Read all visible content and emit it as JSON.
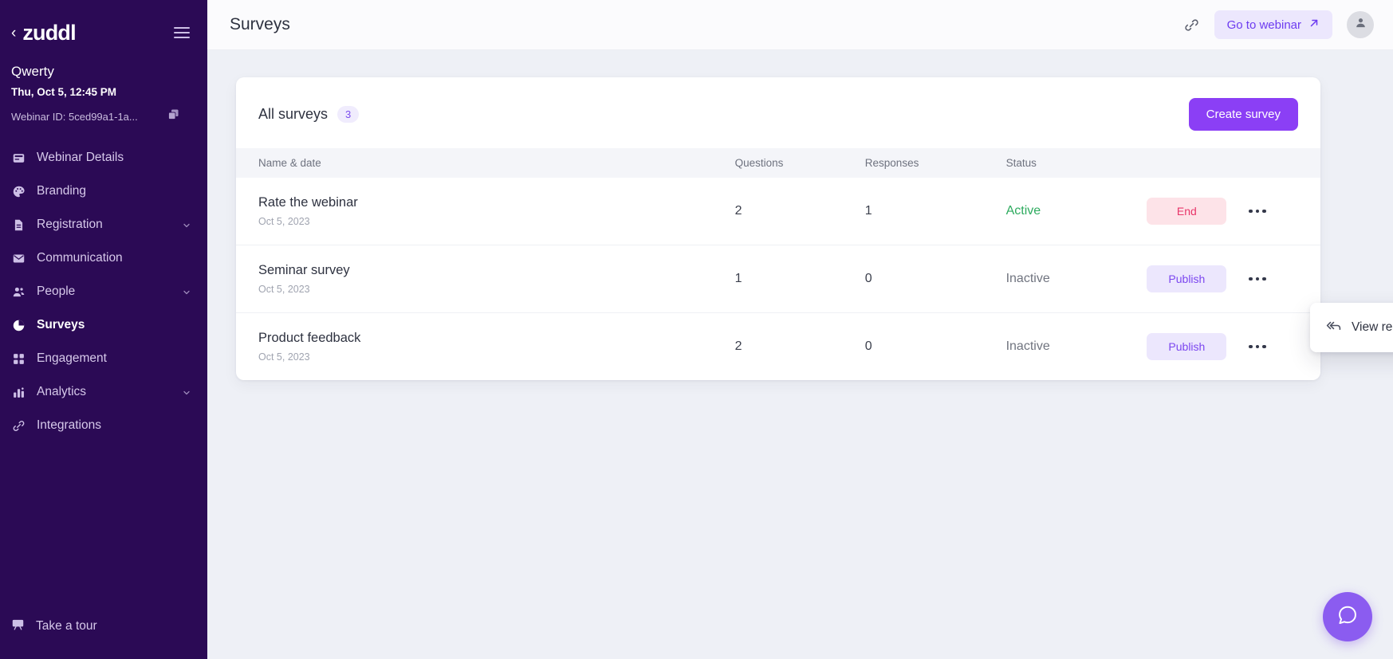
{
  "sidebar": {
    "back_label": "‹",
    "logo": "zuddl",
    "menu_icon": "hamburger-icon",
    "event_name": "Qwerty",
    "event_datetime": "Thu, Oct 5, 12:45 PM",
    "webinar_id": "Webinar ID: 5ced99a1-1a...",
    "copy_icon": "copy-icon",
    "items": [
      {
        "label": "Webinar Details",
        "icon": "card-icon",
        "active": false,
        "expandable": false
      },
      {
        "label": "Branding",
        "icon": "palette-icon",
        "active": false,
        "expandable": false
      },
      {
        "label": "Registration",
        "icon": "document-icon",
        "active": false,
        "expandable": true
      },
      {
        "label": "Communication",
        "icon": "envelope-icon",
        "active": false,
        "expandable": false
      },
      {
        "label": "People",
        "icon": "people-icon",
        "active": false,
        "expandable": true
      },
      {
        "label": "Surveys",
        "icon": "pie-chart-icon",
        "active": true,
        "expandable": false
      },
      {
        "label": "Engagement",
        "icon": "grid-icon",
        "active": false,
        "expandable": false
      },
      {
        "label": "Analytics",
        "icon": "bar-chart-icon",
        "active": false,
        "expandable": true
      },
      {
        "label": "Integrations",
        "icon": "link-icon",
        "active": false,
        "expandable": false
      }
    ],
    "tour_label": "Take a tour",
    "tour_icon": "presentation-icon"
  },
  "topbar": {
    "title": "Surveys",
    "link_icon": "link-icon",
    "webinar_button": "Go to webinar",
    "webinar_button_icon": "arrow-up-right-icon",
    "avatar_icon": "user-icon"
  },
  "card": {
    "title": "All surveys",
    "count": "3",
    "create_button": "Create survey"
  },
  "table": {
    "headers": {
      "name": "Name & date",
      "questions": "Questions",
      "responses": "Responses",
      "status": "Status"
    },
    "rows": [
      {
        "name": "Rate the webinar",
        "date": "Oct 5, 2023",
        "questions": "2",
        "responses": "1",
        "status": "Active",
        "status_state": "active",
        "action_label": "End",
        "action_state": "end",
        "menu_icon": "kebab-menu-icon"
      },
      {
        "name": "Seminar survey",
        "date": "Oct 5, 2023",
        "questions": "1",
        "responses": "0",
        "status": "Inactive",
        "status_state": "inactive",
        "action_label": "Publish",
        "action_state": "publish",
        "menu_icon": "kebab-menu-icon"
      },
      {
        "name": "Product feedback",
        "date": "Oct 5, 2023",
        "questions": "2",
        "responses": "0",
        "status": "Inactive",
        "status_state": "inactive",
        "action_label": "Publish",
        "action_state": "publish",
        "menu_icon": "kebab-menu-icon"
      }
    ]
  },
  "dropdown": {
    "visible": true,
    "items": [
      {
        "label": "View responses",
        "icon": "reply-all-icon"
      }
    ]
  },
  "fab": {
    "icon": "chat-bubble-icon"
  },
  "colors": {
    "sidebar_bg": "#2b0a55",
    "accent": "#8b3ff5",
    "accent_soft": "#ece7fd",
    "active_status": "#2eab5f",
    "danger_soft": "#fde3e8",
    "danger": "#e8366a",
    "page_bg": "#eef0f6"
  }
}
